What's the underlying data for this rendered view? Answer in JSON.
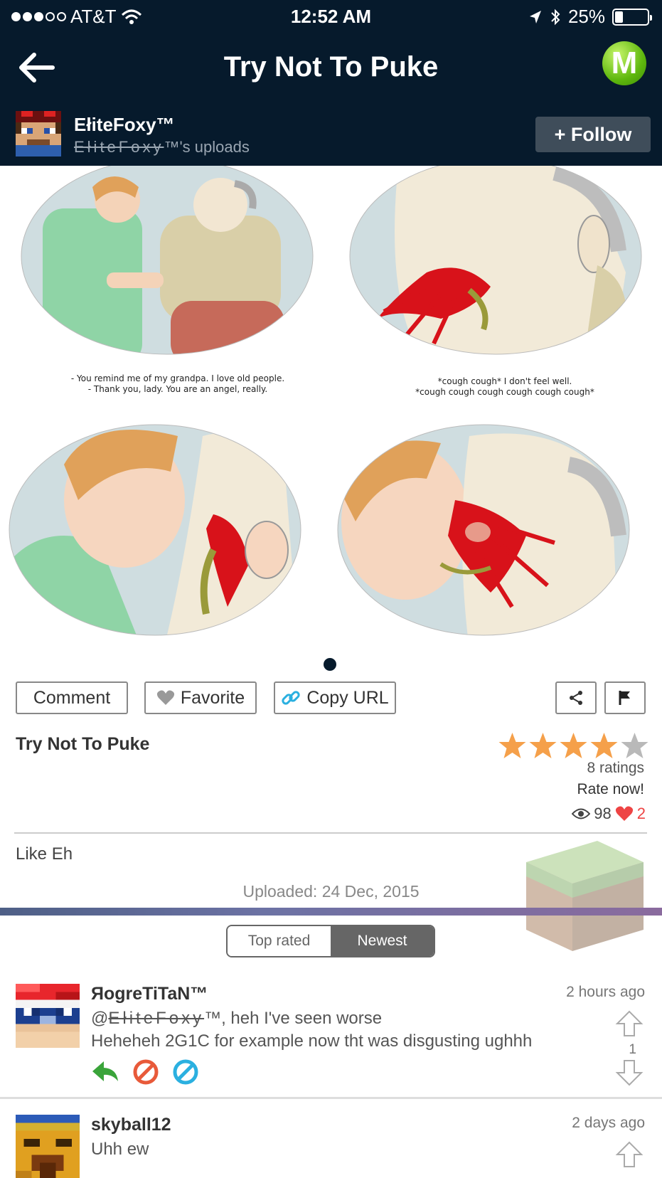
{
  "status_bar": {
    "carrier": "AT&T",
    "time": "12:52 AM",
    "battery": "25%",
    "battery_level": 0.25,
    "signal_bars_filled": 3,
    "signal_bars_total": 5
  },
  "nav": {
    "title": "Try Not To Puke",
    "logo_letter": "M"
  },
  "uploader": {
    "name": "EłiteFoxy™",
    "sub_name": "EłiteFoxy",
    "sub_suffix": "™'s uploads",
    "follow_label": "+ Follow"
  },
  "comic": {
    "captions": [
      "- You remind me of my grandpa. I love old people.\n- Thank you, lady. You are an angel, really.",
      "*cough cough* I don't feel well.\n*cough cough cough cough cough cough*"
    ]
  },
  "actions": {
    "comment": "Comment",
    "favorite": "Favorite",
    "copy_url": "Copy URL"
  },
  "post": {
    "title": "Try Not To Puke",
    "rating_stars": 4,
    "rating_max": 5,
    "ratings_count": "8 ratings",
    "rate_now": "Rate now!",
    "views": "98",
    "likes": "2",
    "description": "Like Eh",
    "uploaded": "Uploaded: 24 Dec, 2015"
  },
  "sort": {
    "top_rated": "Top rated",
    "newest": "Newest",
    "selected": "Newest"
  },
  "comments": [
    {
      "user": "ЯogreTiTaN™",
      "time": "2 hours ago",
      "mention_prefix": "@",
      "mention_name": "EłiteFoxy",
      "line1_rest": "™, heh I've seen worse",
      "line2": "Heheheh 2G1C for example now tht was disgusting ughhh",
      "votes": "1"
    },
    {
      "user": "skyball12",
      "time": "2 days ago",
      "line1": "Uhh ew"
    }
  ],
  "colors": {
    "header_bg": "#061a2c",
    "follow_bg": "#3f4d5a",
    "star_on": "#f5a04a",
    "star_off": "#b9b9b9",
    "heart": "#e44444",
    "reply_green": "#3aa43a",
    "block_red": "#e85a3a",
    "block_blue": "#2bb0e0"
  }
}
